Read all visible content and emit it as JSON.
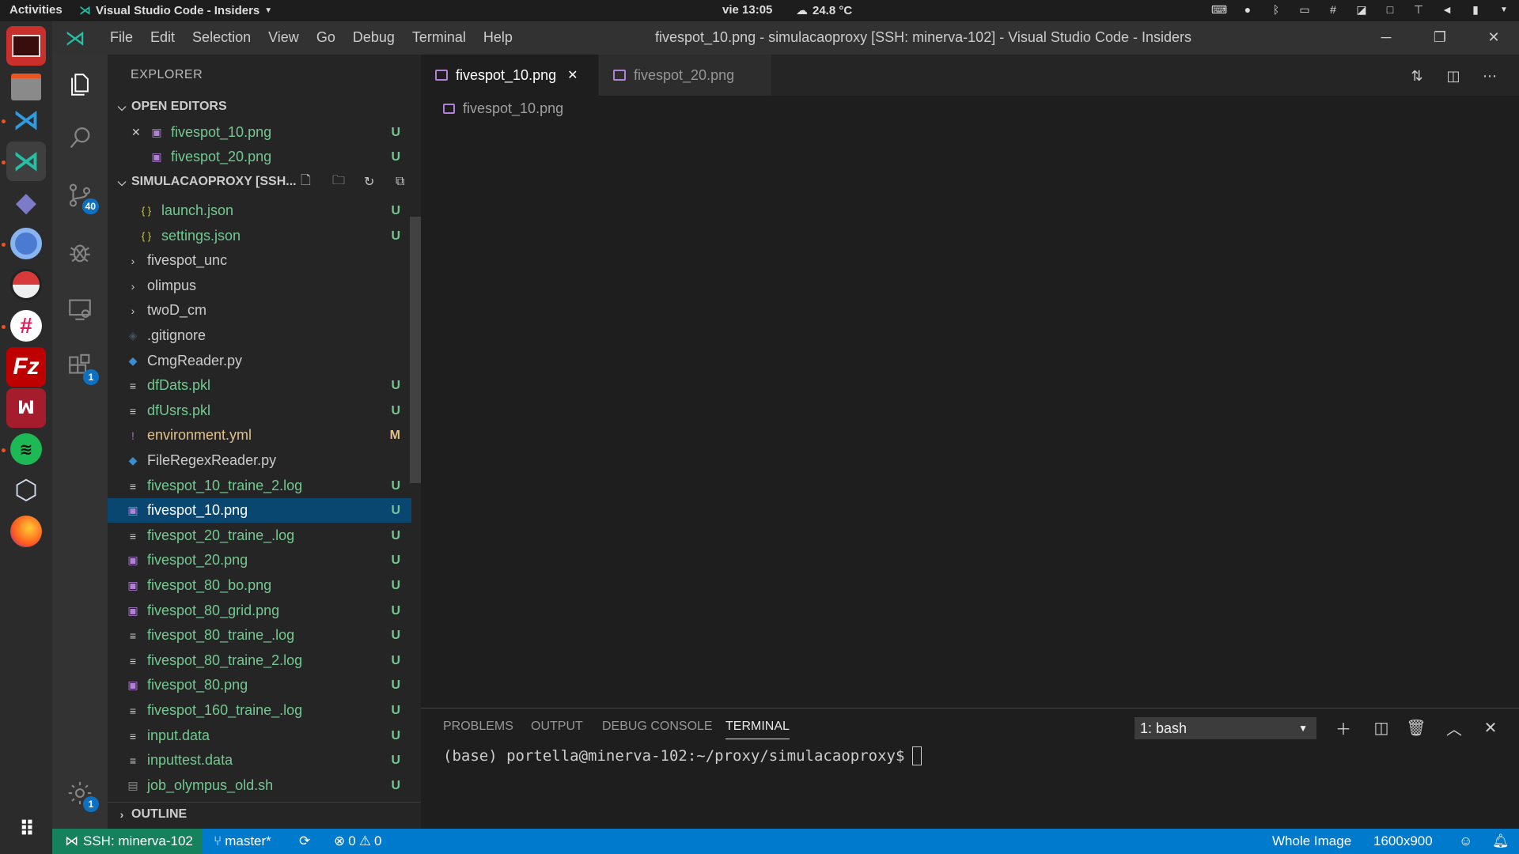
{
  "system": {
    "activities": "Activities",
    "app_name": "Visual Studio Code - Insiders",
    "clock": "vie 13:05",
    "weather": "24.8 °C"
  },
  "window": {
    "title": "fivespot_10.png - simulacaoproxy [SSH: minerva-102] - Visual Studio Code - Insiders",
    "menu": [
      "File",
      "Edit",
      "Selection",
      "View",
      "Go",
      "Debug",
      "Terminal",
      "Help"
    ]
  },
  "activity_bar": {
    "scm_badge": "40",
    "extensions_badge": "1",
    "settings_badge": "1"
  },
  "sidebar": {
    "title": "EXPLORER",
    "open_editors_label": "OPEN EDITORS",
    "open_editors": [
      {
        "name": "fivespot_10.png",
        "status": "U"
      },
      {
        "name": "fivespot_20.png",
        "status": "U"
      }
    ],
    "folder_label": "SIMULACAOPROXY [SSH...",
    "files": [
      {
        "name": "launch.json",
        "status": "U"
      },
      {
        "name": "settings.json",
        "status": "U"
      },
      {
        "name": "fivespot_unc",
        "status": ""
      },
      {
        "name": "olimpus",
        "status": ""
      },
      {
        "name": "twoD_cm",
        "status": ""
      },
      {
        "name": ".gitignore",
        "status": ""
      },
      {
        "name": "CmgReader.py",
        "status": ""
      },
      {
        "name": "dfDats.pkl",
        "status": "U"
      },
      {
        "name": "dfUsrs.pkl",
        "status": "U"
      },
      {
        "name": "environment.yml",
        "status": "M"
      },
      {
        "name": "FileRegexReader.py",
        "status": ""
      },
      {
        "name": "fivespot_10_traine_2.log",
        "status": "U"
      },
      {
        "name": "fivespot_10.png",
        "status": "U"
      },
      {
        "name": "fivespot_20_traine_.log",
        "status": "U"
      },
      {
        "name": "fivespot_20.png",
        "status": "U"
      },
      {
        "name": "fivespot_80_bo.png",
        "status": "U"
      },
      {
        "name": "fivespot_80_grid.png",
        "status": "U"
      },
      {
        "name": "fivespot_80_traine_.log",
        "status": "U"
      },
      {
        "name": "fivespot_80_traine_2.log",
        "status": "U"
      },
      {
        "name": "fivespot_80.png",
        "status": "U"
      },
      {
        "name": "fivespot_160_traine_.log",
        "status": "U"
      },
      {
        "name": "input.data",
        "status": "U"
      },
      {
        "name": "inputtest.data",
        "status": "U"
      },
      {
        "name": "job_olympus_old.sh",
        "status": "U"
      }
    ],
    "outline_label": "OUTLINE"
  },
  "editor": {
    "tabs": [
      {
        "label": "fivespot_10.png"
      },
      {
        "label": "fivespot_20.png"
      }
    ],
    "breadcrumb": "fivespot_10.png"
  },
  "panel": {
    "tabs": [
      "PROBLEMS",
      "OUTPUT",
      "DEBUG CONSOLE",
      "TERMINAL"
    ],
    "terminal_select": "1: bash",
    "prompt": "(base) portella@minerva-102:~/proxy/simulacaoproxy$"
  },
  "statusbar": {
    "remote": "SSH: minerva-102",
    "branch": "master*",
    "errors": "0",
    "warnings": "0",
    "zoom": "Whole Image",
    "image_size": "1600x900"
  },
  "colors": {
    "accent": "#007acc",
    "remote": "#16825d",
    "untracked": "#73c991",
    "modified": "#e2c08d",
    "selection": "#094771"
  }
}
